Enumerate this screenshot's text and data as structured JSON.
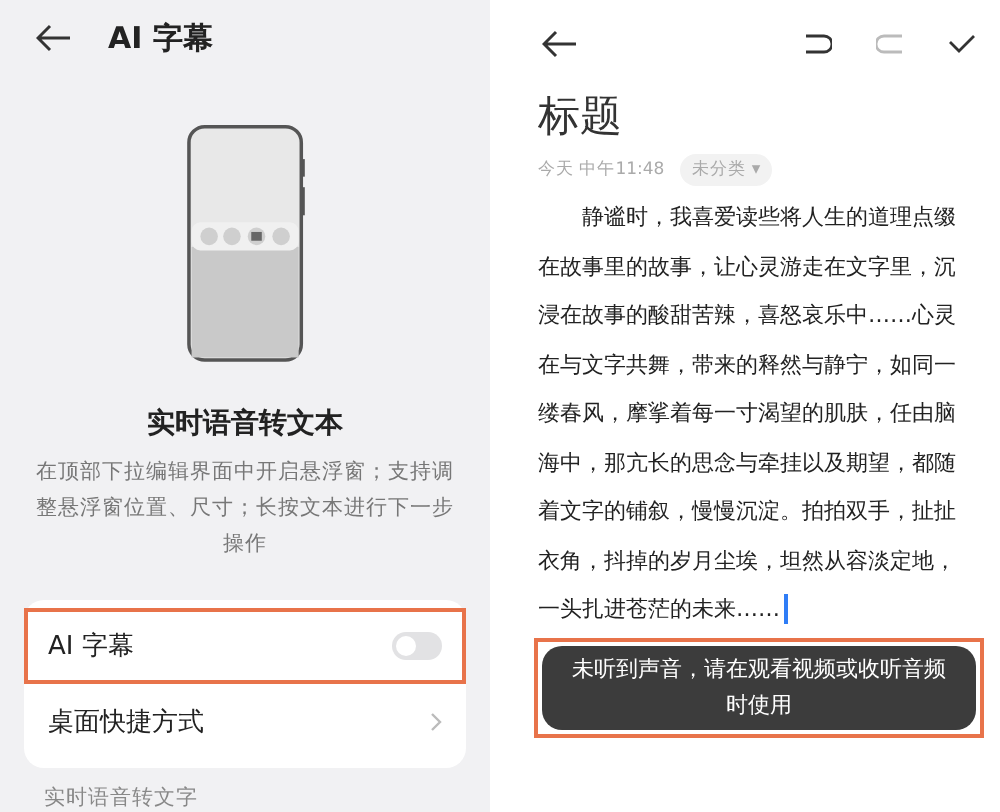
{
  "settings_screen": {
    "title": "AI 字幕",
    "feature_title": "实时语音转文本",
    "feature_description": "在顶部下拉编辑界面中开启悬浮窗；支持调整悬浮窗位置、尺寸；长按文本进行下一步操作",
    "items": [
      {
        "kind": "toggle",
        "label": "AI 字幕",
        "on": false,
        "highlighted": true
      },
      {
        "kind": "link",
        "label": "桌面快捷方式",
        "highlighted": false
      }
    ],
    "section_header": "实时语音转文字"
  },
  "note_screen": {
    "title": "标题",
    "date": "今天 中午11:48",
    "category": "未分类 ▾",
    "body": "静谧时，我喜爱读些将人生的道理点缀在故事里的故事，让心灵游走在文字里，沉浸在故事的酸甜苦辣，喜怒哀乐中……心灵在与文字共舞，带来的释然与静宁，如同一缕春风，摩挲着每一寸渴望的肌肤，任由脑海中，那亢长的思念与牵挂以及期望，都随着文字的铺叙，慢慢沉淀。拍拍双手，扯扯衣角，抖掉的岁月尘埃，坦然从容淡定地，一头扎进苍茫的未来……",
    "toast": {
      "text": "未听到声音，请在观看视频或收听音频时使用",
      "highlighted": true
    }
  }
}
